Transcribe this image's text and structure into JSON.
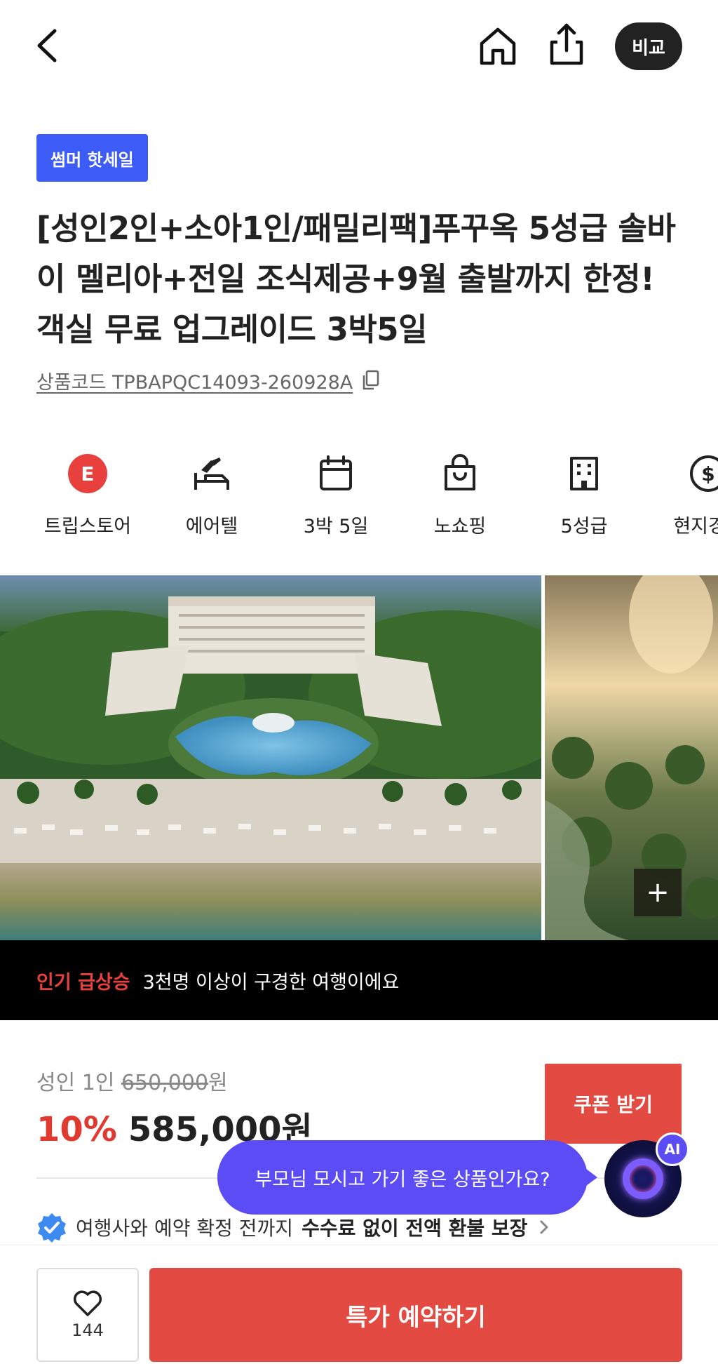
{
  "header": {
    "compare_label": "비교",
    "icons": [
      "back-icon",
      "home-icon",
      "share-icon"
    ]
  },
  "product": {
    "badge": "썸머 핫세일",
    "title": "[성인2인+소아1인/패밀리팩]푸꾸옥 5성급 솔바이 멜리아+전일 조식제공+9월 출발까지 한정! 객실 무료 업그레이드 3박5일",
    "code_label": "상품코드 TPBAPQC14093-260928A"
  },
  "features": [
    {
      "label": "트립스토어",
      "icon": "tripstore-e-icon"
    },
    {
      "label": "에어텔",
      "icon": "airtel-icon"
    },
    {
      "label": "3박 5일",
      "icon": "calendar-icon"
    },
    {
      "label": "노쇼핑",
      "icon": "shopping-bag-icon"
    },
    {
      "label": "5성급",
      "icon": "building-icon"
    },
    {
      "label": "현지경비",
      "icon": "currency-icon"
    }
  ],
  "gallery": {
    "plus_label": "+"
  },
  "popular": {
    "tag": "인기 급상승",
    "text": "3천명 이상이 구경한 여행이에요"
  },
  "price": {
    "label_prefix": "성인 1인 ",
    "original": "650,000",
    "original_unit": "원",
    "discount": "10%",
    "final": "585,000원"
  },
  "coupon_label": "쿠폰 받기",
  "ai": {
    "bubble_text": "부모님 모시고 가기 좋은 상품인가요?",
    "badge": "AI"
  },
  "refund": {
    "text": "여행사와 예약 확정 전까지",
    "strong": "수수료 없이 전액 환불 보장"
  },
  "bottom": {
    "like_count": "144",
    "book_label": "특가 예약하기"
  },
  "colors": {
    "accent_red": "#e24a42",
    "badge_blue": "#3d5bf6",
    "ai_purple": "#5c4cf5"
  }
}
